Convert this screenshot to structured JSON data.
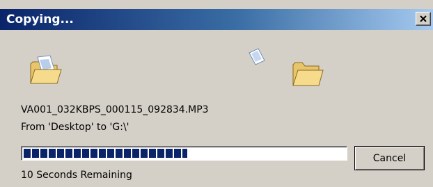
{
  "window": {
    "title": "Copying...",
    "close_label": "×"
  },
  "icons": {
    "source": "folder-icon",
    "flying": "document-icon",
    "destination": "folder-open-icon"
  },
  "copy": {
    "filename": "VA001_032KBPS_000115_092834.MP3",
    "from_to": "From 'Desktop' to 'G:\\'",
    "remaining": "10 Seconds Remaining",
    "progress_fraction": 0.51
  },
  "buttons": {
    "cancel_label": "Cancel"
  },
  "colors": {
    "title_start": "#0a246a",
    "title_end": "#a6caf0",
    "progress_block": "#0a246a",
    "dialog_bg": "#d4d0c8"
  }
}
